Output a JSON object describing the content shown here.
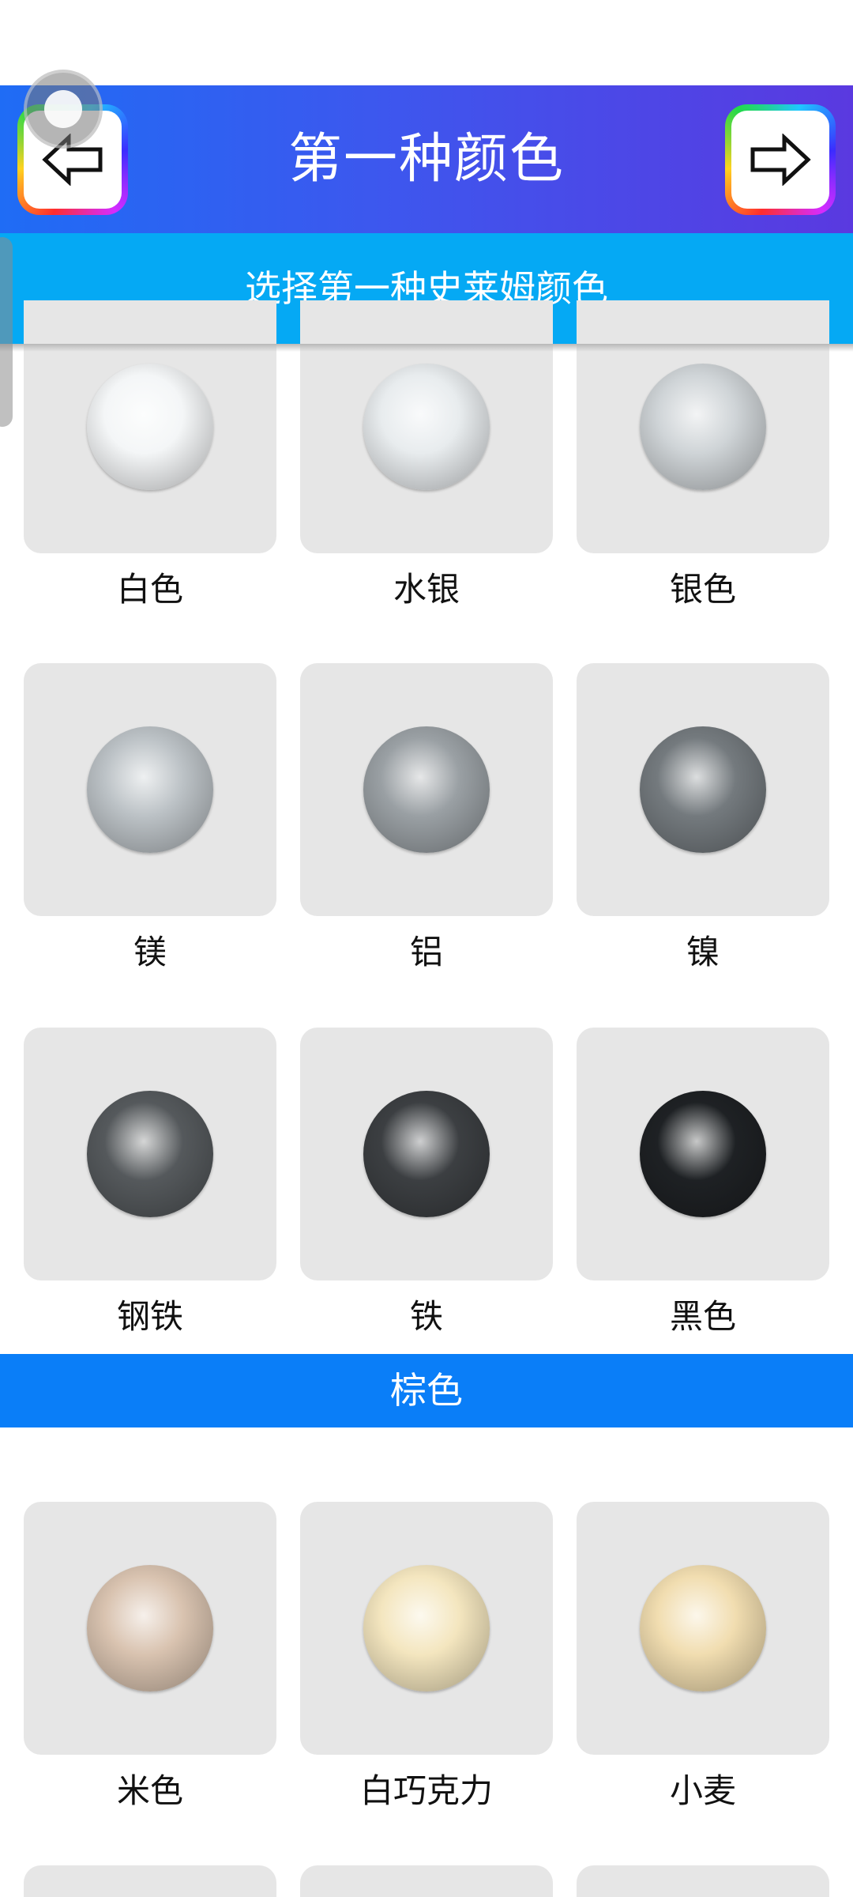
{
  "header": {
    "title": "第一种颜色",
    "back_icon": "arrow-left-icon",
    "next_icon": "arrow-right-icon",
    "gradient": [
      "#1f6cf5",
      "#5a39e0"
    ]
  },
  "subheader": {
    "text": "选择第一种史莱姆颜色",
    "color": "#05a9f4"
  },
  "sections": {
    "metals": {
      "items": [
        {
          "label": "白色",
          "color": "#f4f6f7"
        },
        {
          "label": "水银",
          "color": "#e8ecee"
        },
        {
          "label": "银色",
          "color": "#cfd4d7"
        },
        {
          "label": "镁",
          "color": "#bcc2c6"
        },
        {
          "label": "铝",
          "color": "#9aa0a4"
        },
        {
          "label": "镍",
          "color": "#747a7e"
        },
        {
          "label": "钢铁",
          "color": "#55595c"
        },
        {
          "label": "铁",
          "color": "#3c3f42"
        },
        {
          "label": "黑色",
          "color": "#1e2124"
        }
      ]
    },
    "brown": {
      "title": "棕色",
      "color": "#0a7ef8",
      "items": [
        {
          "label": "米色",
          "color": "#d9c3b0"
        },
        {
          "label": "白巧克力",
          "color": "#f4e6bf"
        },
        {
          "label": "小麦",
          "color": "#f1ddb0"
        }
      ]
    }
  }
}
